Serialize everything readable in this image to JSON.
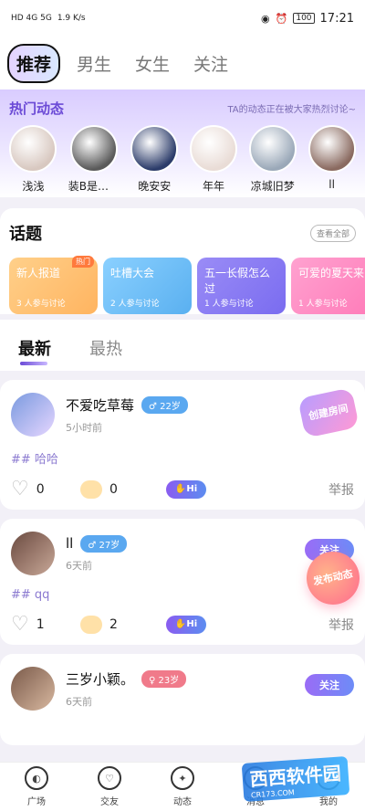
{
  "status_bar": {
    "left_text": "HD 4G 5G",
    "speed": "1.9 K/s",
    "battery": "100",
    "time": "17:21"
  },
  "top_tabs": [
    "推荐",
    "男生",
    "女生",
    "关注"
  ],
  "hot": {
    "title": "热门动态",
    "subtitle": "TA的动态正在被大家热烈讨论~",
    "users": [
      {
        "name": "浅浅",
        "color": "#d8c8c0"
      },
      {
        "name": "装B是挨…",
        "color": "#5a5a5a"
      },
      {
        "name": "晚安安",
        "color": "#2c3c6a"
      },
      {
        "name": "年年",
        "color": "#e9dcd6"
      },
      {
        "name": "凉城旧梦",
        "color": "#9aa8b8"
      },
      {
        "name": "ll",
        "color": "#8a6a60"
      }
    ]
  },
  "topics": {
    "title": "话题",
    "all_label": "查看全部",
    "items": [
      {
        "name": "新人报道",
        "count": "3 人参与讨论",
        "badge": "热门",
        "gradient": "linear-gradient(135deg,#ffd08a,#ffb460)"
      },
      {
        "name": "吐槽大会",
        "count": "2 人参与讨论",
        "badge": "",
        "gradient": "linear-gradient(135deg,#8ad0ff,#5ab0f0)"
      },
      {
        "name": "五一长假怎么过",
        "count": "1 人参与讨论",
        "badge": "",
        "gradient": "linear-gradient(135deg,#9a8cf6,#7a6cf0)"
      },
      {
        "name": "可爱的夏天来",
        "count": "1 人参与讨论",
        "badge": "",
        "gradient": "linear-gradient(135deg,#ffa2d0,#ff7ab8)"
      }
    ]
  },
  "feed_tabs": [
    "最新",
    "最热"
  ],
  "posts": [
    {
      "name": "不爱吃草莓",
      "age": "♂ 22岁",
      "age_color": "#5aa8f0",
      "time": "5小时前",
      "tag": "## 哈哈",
      "likes": "0",
      "comments": "0",
      "hi": "Hi",
      "report": "举报",
      "avatar_color": "#7a9adf",
      "action": "创建房间"
    },
    {
      "name": "ll",
      "age": "♂ 27岁",
      "age_color": "#5aa8f0",
      "time": "6天前",
      "tag": "## qq",
      "likes": "1",
      "comments": "2",
      "hi": "Hi",
      "report": "举报",
      "avatar_color": "#6a4a40",
      "action": "关注",
      "publish": "发布动态"
    },
    {
      "name": "三岁小颖。",
      "age": "♀ 23岁",
      "age_color": "#f07a8a",
      "time": "6天前",
      "avatar_color": "#7a5a4a",
      "action": "关注"
    }
  ],
  "bottom_nav": [
    "广场",
    "交友",
    "动态",
    "消息",
    "我的"
  ],
  "watermark": {
    "main": "西西软件园",
    "sub": "CR173.COM"
  }
}
